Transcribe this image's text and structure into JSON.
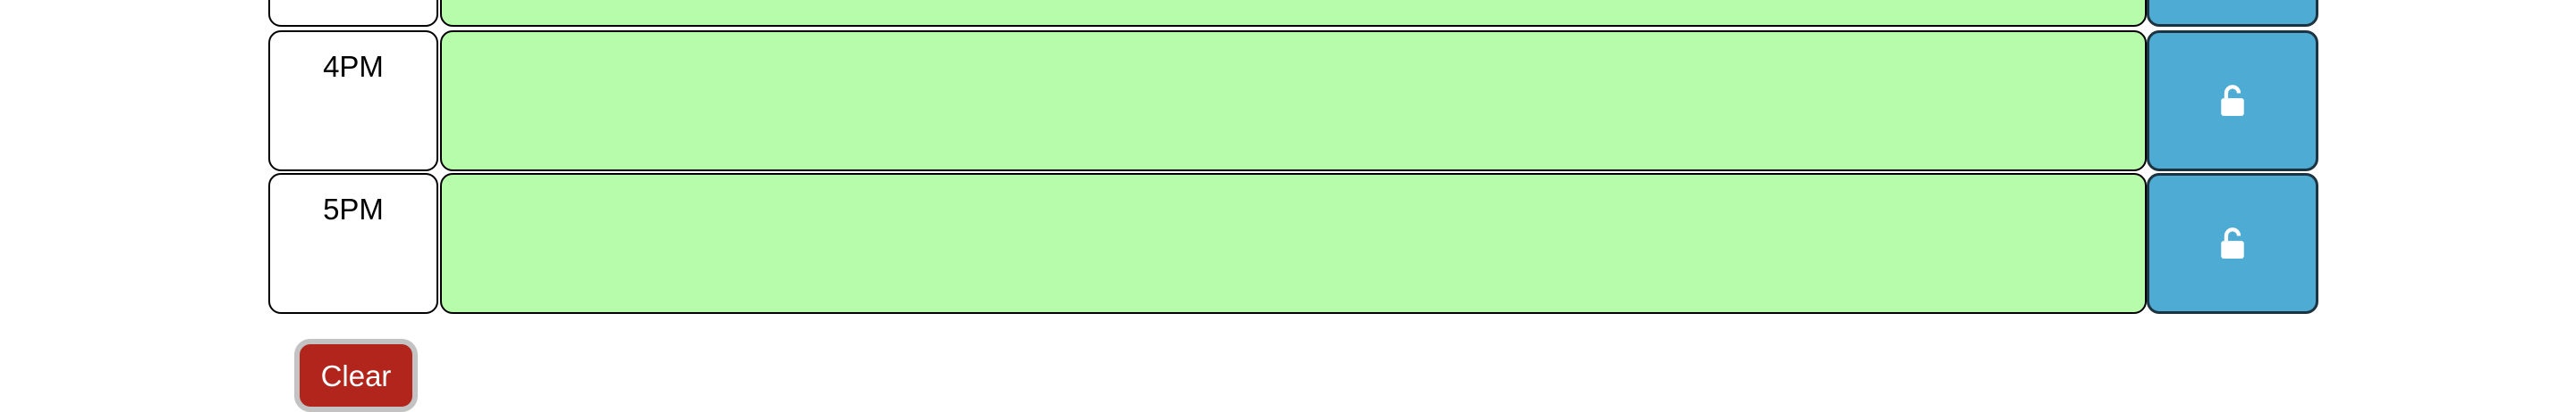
{
  "planner": {
    "rows": [
      {
        "hour": "",
        "status": "future",
        "save_icon": "unlock-icon"
      },
      {
        "hour": "4PM",
        "status": "future",
        "save_icon": "unlock-icon"
      },
      {
        "hour": "5PM",
        "status": "future",
        "save_icon": "unlock-icon"
      }
    ],
    "colors": {
      "future_bg": "#b6fcaa",
      "save_button_bg": "#4dabd4",
      "clear_button_bg": "#b2251d"
    }
  },
  "actions": {
    "clear_label": "Clear"
  }
}
